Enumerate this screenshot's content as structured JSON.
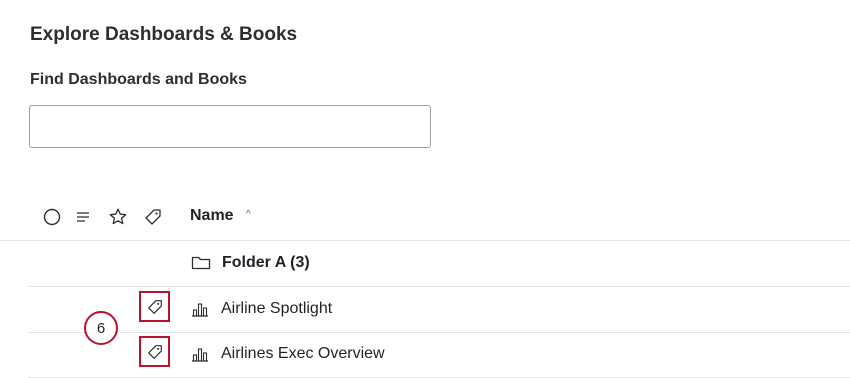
{
  "page": {
    "title": "Explore Dashboards & Books",
    "search_label": "Find Dashboards and Books",
    "search_value": "",
    "search_placeholder": ""
  },
  "list_header": {
    "icons": [
      "circle-select-icon",
      "lines-icon",
      "star-icon",
      "tag-icon"
    ],
    "name_column": "Name",
    "sort_indicator": "^"
  },
  "rows": [
    {
      "type": "folder",
      "icon": "folder-icon",
      "label": "Folder A (3)"
    },
    {
      "type": "dashboard",
      "icon": "bar-chart-icon",
      "tag_icon": "tag-icon",
      "label": "Airline Spotlight",
      "tag_highlighted": true
    },
    {
      "type": "dashboard",
      "icon": "bar-chart-icon",
      "tag_icon": "tag-icon",
      "label": "Airlines Exec Overview",
      "tag_highlighted": true
    }
  ],
  "callout": {
    "number": "6"
  },
  "colors": {
    "highlight": "#b8132f",
    "divider": "#e2e4e6",
    "text": "#1f2328"
  }
}
